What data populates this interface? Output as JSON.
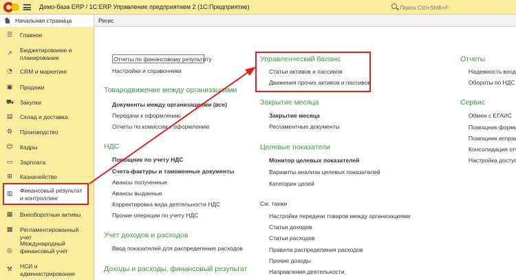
{
  "titlebar": {
    "app_title": "Демо-база ERP / 1С:ERP Управление предприятием 2  (1С:Предприятие)",
    "search_placeholder": "Поиск Ctrl+Shift+F"
  },
  "tabs": {
    "home": "Начальная страница",
    "next": "Регис"
  },
  "sidebar": {
    "items": [
      {
        "icon": "☰",
        "label": "Главное"
      },
      {
        "icon": "↗",
        "label": "Бюджетирование и планирование"
      },
      {
        "icon": "◔",
        "label": "CRM и маркетинг"
      },
      {
        "icon": "▣",
        "label": "Продажи"
      },
      {
        "icon": "⛟",
        "label": "Закупки"
      },
      {
        "icon": "▤",
        "label": "Склад и доставка"
      },
      {
        "icon": "⚙",
        "label": "Производство"
      },
      {
        "icon": "☺",
        "label": "Кадры"
      },
      {
        "icon": "▭",
        "label": "Зарплата"
      },
      {
        "icon": "⊞",
        "label": "Казначейство"
      },
      {
        "icon": "▥",
        "label": "Финансовый результат и контроллинг"
      },
      {
        "icon": "▦",
        "label": "Внеоборотные активы"
      },
      {
        "icon": "▩",
        "label": "Регламентированный учет"
      },
      {
        "icon": "◎",
        "label": "Международный финансовый учет"
      },
      {
        "icon": "⚒",
        "label": "НСИ и администрирование"
      }
    ]
  },
  "col1": {
    "top_links": [
      "Отчеты по финансовому результату",
      "Настройки и справочники"
    ],
    "sec1": {
      "title": "Товародвижение между организациями",
      "links": [
        "Документы между организациями (все)",
        "Передачи к оформлению",
        "Отчеты по комиссии к оформлению"
      ]
    },
    "sec2": {
      "title": "НДС",
      "links": [
        "Помощник по учету НДС",
        "Счета-фактуры и таможенные документы",
        "Авансы полученные",
        "Авансы выданные",
        "Корректировка вида деятельности НДС",
        "Прочие операции по учету НДС"
      ]
    },
    "sec3": {
      "title": "Учет доходов и расходов",
      "links": [
        "Ввод показателей для распределения расходов"
      ]
    },
    "sec4": {
      "title": "Доходы и расходы, финансовый результат"
    }
  },
  "col2": {
    "sec1": {
      "title": "Управленческий баланс",
      "links": [
        "Статьи активов и пассивов",
        "Движения прочих активов и пассивов"
      ]
    },
    "sec2": {
      "title": "Закрытие месяца",
      "links": [
        "Закрытие месяца",
        "Регламентные документы"
      ]
    },
    "sec3": {
      "title": "Целевые показатели",
      "links": [
        "Монитор целевых показателей",
        "Варианты анализа целевых показателей",
        "Категории целей"
      ]
    },
    "see_also": "См. также",
    "see_links": [
      "Настройки передачи товаров между организациями",
      "Статьи доходов",
      "Статьи расходов",
      "Правила распределения расходов",
      "Прочие доходы",
      "Направления деятельности"
    ]
  },
  "col3": {
    "sec1": {
      "title": "Отчеты",
      "links": [
        "Надежность входя",
        "Обороты по НДС"
      ]
    },
    "sec2": {
      "title": "Сервис",
      "links": [
        "Обмен с ЕГАИС",
        "Помощник формир",
        "Помощник исправ",
        "Консолидация отч",
        "Настройка доступ"
      ]
    }
  },
  "colors": {
    "accent_green": "#3a9a3a",
    "highlight_red": "#e0201a",
    "sidebar_bg": "#fbed9e"
  }
}
